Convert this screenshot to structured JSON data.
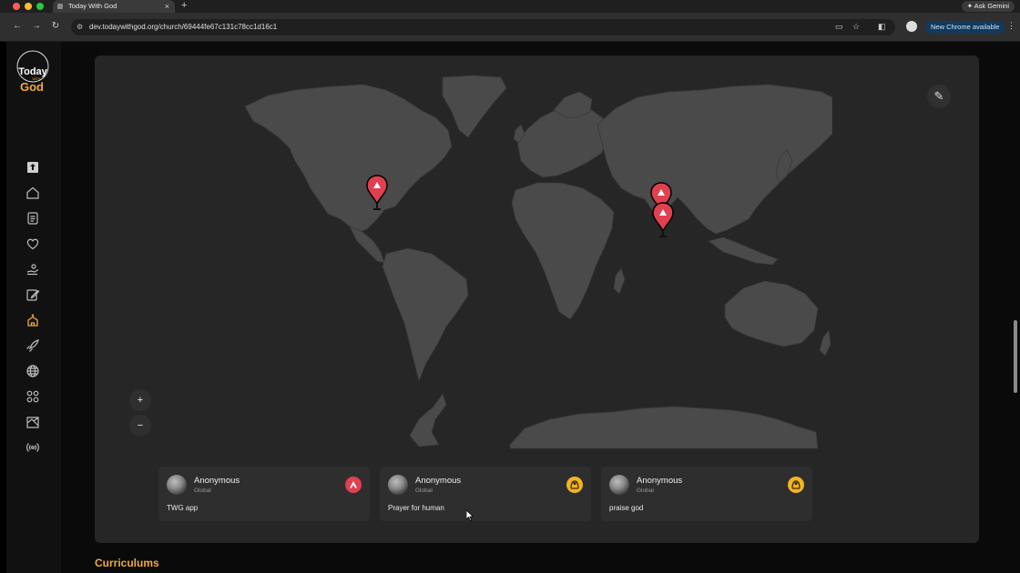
{
  "browser": {
    "tab_title": "Today With God",
    "tab_close": "×",
    "new_tab": "+",
    "url": "dev.todaywithgod.org/church/69444fe67c131c78cc1d16c1",
    "ask_gemini": "Ask Gemini",
    "update_label": "New Chrome available",
    "traffic_colors": [
      "#ff5f57",
      "#febc2e",
      "#28c840"
    ]
  },
  "logo": {
    "line1": "Today",
    "line2": "WITH",
    "line3": "God",
    "accent": "#f2a93b"
  },
  "sidebar": {
    "items": [
      {
        "name": "upload-icon"
      },
      {
        "name": "home-icon"
      },
      {
        "name": "list-icon"
      },
      {
        "name": "heart-icon"
      },
      {
        "name": "giving-icon"
      },
      {
        "name": "edit-note-icon"
      },
      {
        "name": "church-icon",
        "active": true
      },
      {
        "name": "rocket-icon"
      },
      {
        "name": "globe-icon"
      },
      {
        "name": "grid-icon"
      },
      {
        "name": "map-icon"
      },
      {
        "name": "broadcast-icon"
      }
    ],
    "active_color": "#f2a93b"
  },
  "map": {
    "land_color": "#4a4a4a",
    "pin_color": "#e0404f",
    "pins": [
      "north-america",
      "central-asia",
      "india"
    ],
    "zoom_in": "+",
    "zoom_out": "−"
  },
  "prayers": [
    {
      "name": "Anonymous",
      "location": "Global",
      "text": "TWG app",
      "badge": "prayer-hands-icon",
      "badge_color": "#e0404f"
    },
    {
      "name": "Anonymous",
      "location": "Global",
      "text": "Prayer for human",
      "badge": "praise-hands-icon",
      "badge_color": "#f2b51f"
    },
    {
      "name": "Anonymous",
      "location": "Global",
      "text": "praise god",
      "badge": "praise-hands-icon",
      "badge_color": "#f2b51f"
    }
  ],
  "section": {
    "title": "Curriculums"
  }
}
